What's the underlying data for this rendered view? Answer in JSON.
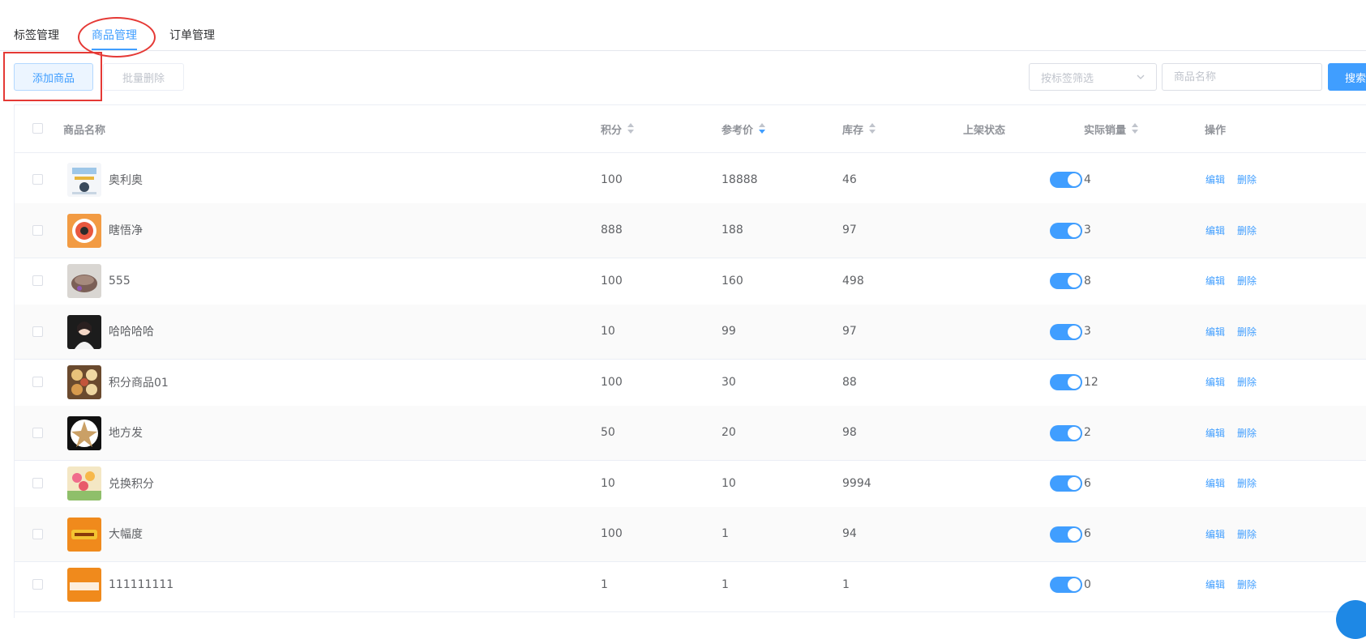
{
  "tabs": [
    {
      "label": "标签管理"
    },
    {
      "label": "商品管理",
      "active": true
    },
    {
      "label": "订单管理"
    }
  ],
  "toolbar": {
    "add_label": "添加商品",
    "batch_delete_label": "批量删除",
    "tag_filter_placeholder": "按标签筛选",
    "name_placeholder": "商品名称",
    "search_label": "搜索"
  },
  "colors": {
    "accent": "#409eff",
    "annotation_red": "#e53935"
  },
  "table": {
    "headers": {
      "name": "商品名称",
      "points": "积分",
      "ref_price": "参考价",
      "stock": "库存",
      "status": "上架状态",
      "sales": "实际销量",
      "actions": "操作"
    },
    "sort": {
      "ref_price": "desc"
    },
    "edit_label": "编辑",
    "delete_label": "删除",
    "rows": [
      {
        "name": "奥利奥",
        "points": "100",
        "ref_price": "18888",
        "stock": "46",
        "sales": "4",
        "on_shelf": true,
        "thumb_icon": "poster-thumbnail"
      },
      {
        "name": "瞎悟净",
        "points": "888",
        "ref_price": "188",
        "stock": "97",
        "sales": "3",
        "on_shelf": true,
        "thumb_icon": "shrimp-dish-thumbnail"
      },
      {
        "name": "555",
        "points": "100",
        "ref_price": "160",
        "stock": "498",
        "sales": "8",
        "on_shelf": true,
        "thumb_icon": "dessert-bowl-thumbnail"
      },
      {
        "name": "哈哈哈哈",
        "points": "10",
        "ref_price": "99",
        "stock": "97",
        "sales": "3",
        "on_shelf": true,
        "thumb_icon": "portrait-thumbnail"
      },
      {
        "name": "积分商品01",
        "points": "100",
        "ref_price": "30",
        "stock": "88",
        "sales": "12",
        "on_shelf": true,
        "thumb_icon": "food-platter-thumbnail"
      },
      {
        "name": "地方发",
        "points": "50",
        "ref_price": "20",
        "stock": "98",
        "sales": "2",
        "on_shelf": true,
        "thumb_icon": "starfish-dish-thumbnail"
      },
      {
        "name": "兑换积分",
        "points": "10",
        "ref_price": "10",
        "stock": "9994",
        "sales": "6",
        "on_shelf": true,
        "thumb_icon": "flowers-thumbnail"
      },
      {
        "name": "大幅度",
        "points": "100",
        "ref_price": "1",
        "stock": "94",
        "sales": "6",
        "on_shelf": true,
        "thumb_icon": "orange-logo-thumbnail"
      },
      {
        "name": "111111111",
        "points": "1",
        "ref_price": "1",
        "stock": "1",
        "sales": "0",
        "on_shelf": true,
        "thumb_icon": "midea-logo-thumbnail"
      }
    ]
  }
}
